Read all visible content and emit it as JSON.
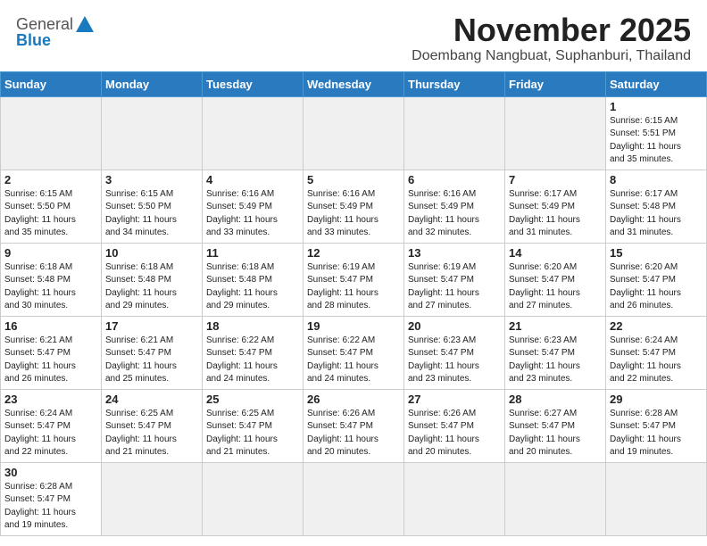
{
  "header": {
    "logo_general": "General",
    "logo_blue": "Blue",
    "month": "November 2025",
    "location": "Doembang Nangbuat, Suphanburi, Thailand"
  },
  "weekdays": [
    "Sunday",
    "Monday",
    "Tuesday",
    "Wednesday",
    "Thursday",
    "Friday",
    "Saturday"
  ],
  "days": [
    {
      "day": null,
      "info": ""
    },
    {
      "day": null,
      "info": ""
    },
    {
      "day": null,
      "info": ""
    },
    {
      "day": null,
      "info": ""
    },
    {
      "day": null,
      "info": ""
    },
    {
      "day": null,
      "info": ""
    },
    {
      "day": "1",
      "info": "Sunrise: 6:15 AM\nSunset: 5:51 PM\nDaylight: 11 hours\nand 35 minutes."
    },
    {
      "day": "2",
      "info": "Sunrise: 6:15 AM\nSunset: 5:50 PM\nDaylight: 11 hours\nand 35 minutes."
    },
    {
      "day": "3",
      "info": "Sunrise: 6:15 AM\nSunset: 5:50 PM\nDaylight: 11 hours\nand 34 minutes."
    },
    {
      "day": "4",
      "info": "Sunrise: 6:16 AM\nSunset: 5:49 PM\nDaylight: 11 hours\nand 33 minutes."
    },
    {
      "day": "5",
      "info": "Sunrise: 6:16 AM\nSunset: 5:49 PM\nDaylight: 11 hours\nand 33 minutes."
    },
    {
      "day": "6",
      "info": "Sunrise: 6:16 AM\nSunset: 5:49 PM\nDaylight: 11 hours\nand 32 minutes."
    },
    {
      "day": "7",
      "info": "Sunrise: 6:17 AM\nSunset: 5:49 PM\nDaylight: 11 hours\nand 31 minutes."
    },
    {
      "day": "8",
      "info": "Sunrise: 6:17 AM\nSunset: 5:48 PM\nDaylight: 11 hours\nand 31 minutes."
    },
    {
      "day": "9",
      "info": "Sunrise: 6:18 AM\nSunset: 5:48 PM\nDaylight: 11 hours\nand 30 minutes."
    },
    {
      "day": "10",
      "info": "Sunrise: 6:18 AM\nSunset: 5:48 PM\nDaylight: 11 hours\nand 29 minutes."
    },
    {
      "day": "11",
      "info": "Sunrise: 6:18 AM\nSunset: 5:48 PM\nDaylight: 11 hours\nand 29 minutes."
    },
    {
      "day": "12",
      "info": "Sunrise: 6:19 AM\nSunset: 5:47 PM\nDaylight: 11 hours\nand 28 minutes."
    },
    {
      "day": "13",
      "info": "Sunrise: 6:19 AM\nSunset: 5:47 PM\nDaylight: 11 hours\nand 27 minutes."
    },
    {
      "day": "14",
      "info": "Sunrise: 6:20 AM\nSunset: 5:47 PM\nDaylight: 11 hours\nand 27 minutes."
    },
    {
      "day": "15",
      "info": "Sunrise: 6:20 AM\nSunset: 5:47 PM\nDaylight: 11 hours\nand 26 minutes."
    },
    {
      "day": "16",
      "info": "Sunrise: 6:21 AM\nSunset: 5:47 PM\nDaylight: 11 hours\nand 26 minutes."
    },
    {
      "day": "17",
      "info": "Sunrise: 6:21 AM\nSunset: 5:47 PM\nDaylight: 11 hours\nand 25 minutes."
    },
    {
      "day": "18",
      "info": "Sunrise: 6:22 AM\nSunset: 5:47 PM\nDaylight: 11 hours\nand 24 minutes."
    },
    {
      "day": "19",
      "info": "Sunrise: 6:22 AM\nSunset: 5:47 PM\nDaylight: 11 hours\nand 24 minutes."
    },
    {
      "day": "20",
      "info": "Sunrise: 6:23 AM\nSunset: 5:47 PM\nDaylight: 11 hours\nand 23 minutes."
    },
    {
      "day": "21",
      "info": "Sunrise: 6:23 AM\nSunset: 5:47 PM\nDaylight: 11 hours\nand 23 minutes."
    },
    {
      "day": "22",
      "info": "Sunrise: 6:24 AM\nSunset: 5:47 PM\nDaylight: 11 hours\nand 22 minutes."
    },
    {
      "day": "23",
      "info": "Sunrise: 6:24 AM\nSunset: 5:47 PM\nDaylight: 11 hours\nand 22 minutes."
    },
    {
      "day": "24",
      "info": "Sunrise: 6:25 AM\nSunset: 5:47 PM\nDaylight: 11 hours\nand 21 minutes."
    },
    {
      "day": "25",
      "info": "Sunrise: 6:25 AM\nSunset: 5:47 PM\nDaylight: 11 hours\nand 21 minutes."
    },
    {
      "day": "26",
      "info": "Sunrise: 6:26 AM\nSunset: 5:47 PM\nDaylight: 11 hours\nand 20 minutes."
    },
    {
      "day": "27",
      "info": "Sunrise: 6:26 AM\nSunset: 5:47 PM\nDaylight: 11 hours\nand 20 minutes."
    },
    {
      "day": "28",
      "info": "Sunrise: 6:27 AM\nSunset: 5:47 PM\nDaylight: 11 hours\nand 20 minutes."
    },
    {
      "day": "29",
      "info": "Sunrise: 6:28 AM\nSunset: 5:47 PM\nDaylight: 11 hours\nand 19 minutes."
    },
    {
      "day": "30",
      "info": "Sunrise: 6:28 AM\nSunset: 5:47 PM\nDaylight: 11 hours\nand 19 minutes."
    },
    {
      "day": null,
      "info": ""
    },
    {
      "day": null,
      "info": ""
    },
    {
      "day": null,
      "info": ""
    },
    {
      "day": null,
      "info": ""
    },
    {
      "day": null,
      "info": ""
    },
    {
      "day": null,
      "info": ""
    }
  ]
}
